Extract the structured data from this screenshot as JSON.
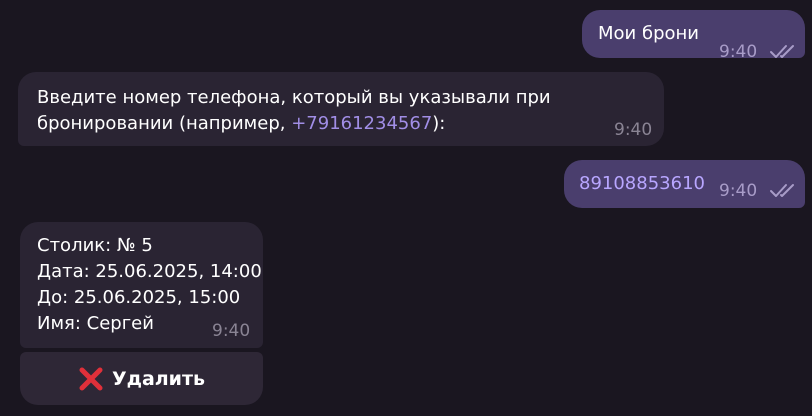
{
  "messages": [
    {
      "direction": "out",
      "text": "Мои брони",
      "time": "9:40",
      "status_icon": "double-check-icon"
    },
    {
      "direction": "in",
      "text_before_link": "Введите номер телефона, который вы указывали при бронировании (например, ",
      "link_text": "+79161234567",
      "text_after_link": "):",
      "time": "9:40"
    },
    {
      "direction": "out",
      "text": "89108853610",
      "time": "9:40",
      "status_icon": "double-check-icon"
    },
    {
      "direction": "in",
      "lines": [
        "Столик: № 5",
        "Дата: 25.06.2025, 14:00",
        "До: 25.06.2025, 15:00",
        "Имя: Сергей"
      ],
      "time": "9:40"
    }
  ],
  "inline_button": {
    "icon": "cross-mark-icon",
    "label": "Удалить"
  },
  "colors": {
    "background": "#1a1620",
    "outgoing_bubble": "#4a3e6d",
    "incoming_bubble": "#2a2433",
    "link": "#a18ee6",
    "delete_icon": "#e0303a"
  }
}
